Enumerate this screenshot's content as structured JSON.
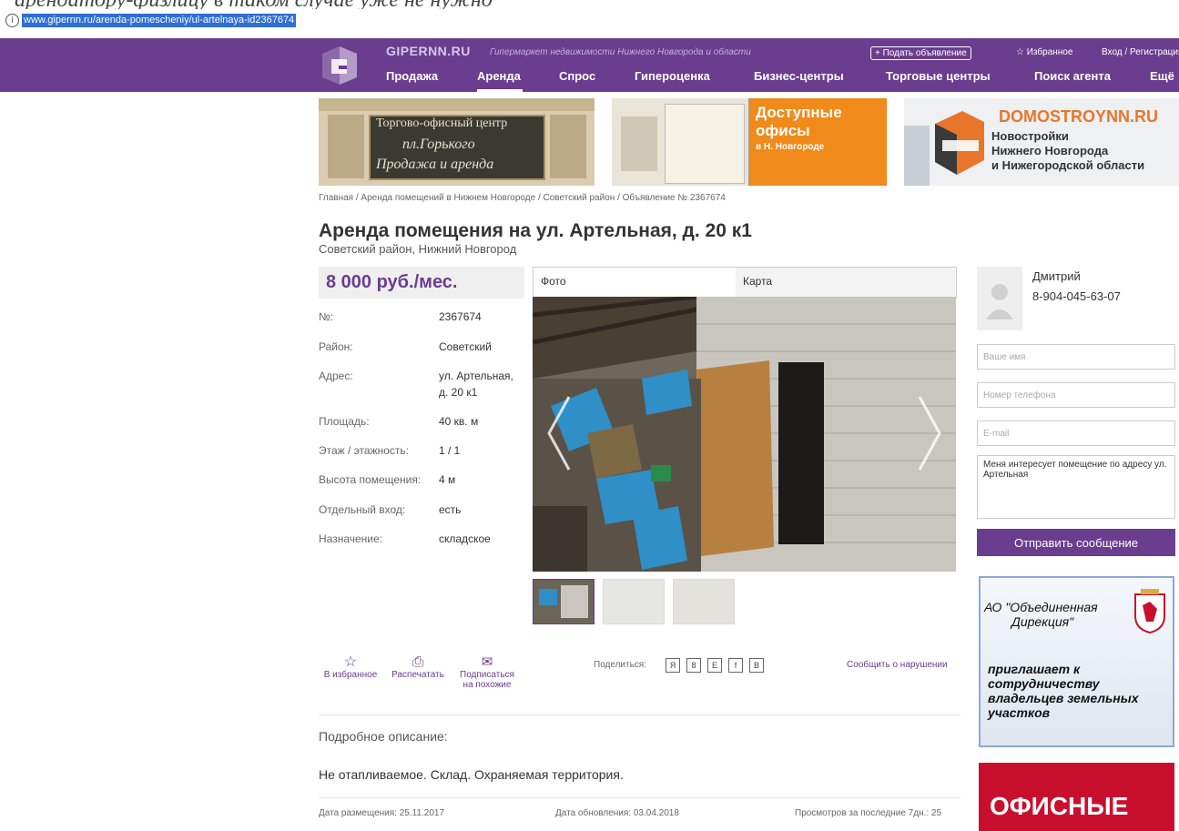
{
  "browser": {
    "url": "www.gipernn.ru/arenda-pomescheniy/ul-artelnaya-id2367674",
    "top_overlay_text": "арендатору-физлицу в таком случае уже не нужно"
  },
  "header": {
    "brand": "GIPERNN.RU",
    "tagline": "Гипермаркет недвижимости Нижнего Новгорода и области",
    "post_ad": "+ Подать объявление",
    "favorites": "☆ Избранное",
    "login": "Вход / Регистрация",
    "nav": [
      "Продажа",
      "Аренда",
      "Спрос",
      "Гипероценка",
      "Бизнес-центры",
      "Торговые центры",
      "Поиск агента",
      "Ещё"
    ],
    "active_nav": "Аренда",
    "colors": {
      "header_bg": "#6a3d8f"
    }
  },
  "banners": {
    "b1": {
      "line1": "Торгово-офисный центр",
      "line2": "пл.Горького",
      "line3": "Продажа и аренда"
    },
    "b2": {
      "line1": "Доступные",
      "line2": "офисы",
      "line3": "в Н. Новгороде"
    },
    "b3": {
      "brand": "DOMOSTROYNN.RU",
      "line1": "Новостройки",
      "line2": "Нижнего Новгорода",
      "line3": "и Нижегородской области"
    }
  },
  "breadcrumb": "Главная / Аренда помещений в Нижнем Новгороде / Советский район / Объявление № 2367674",
  "listing": {
    "title": "Аренда помещения на ул. Артельная, д. 20 к1",
    "subtitle": "Советский район, Нижний Новгород",
    "price": "8 000 руб./мес.",
    "props": [
      {
        "k": "№:",
        "v": "2367674"
      },
      {
        "k": "Район:",
        "v": "Советский"
      },
      {
        "k": "Адрес:",
        "v": "ул. Артельная,",
        "v2": "д. 20 к1"
      },
      {
        "k": "Площадь:",
        "v": "40 кв. м"
      },
      {
        "k": "Этаж / этажность:",
        "v": "1 / 1"
      },
      {
        "k": "Высота помещения:",
        "v": "4 м"
      },
      {
        "k": "Отдельный вход:",
        "v": "есть"
      },
      {
        "k": "Назначение:",
        "v": "складское"
      }
    ]
  },
  "gallery": {
    "tab_photo": "Фото",
    "tab_map": "Карта"
  },
  "actions": {
    "favorite": "В избранное",
    "print": "Распечатать",
    "subscribe1": "Подписаться",
    "subscribe2": "на похожие",
    "share": "Поделиться:",
    "share_icons": [
      "Я",
      "8",
      "Е",
      "f",
      "В"
    ],
    "report": "Сообщить о нарушении"
  },
  "description": {
    "heading": "Подробное описание:",
    "text": "Не отапливаемое. Склад. Охраняемая территория."
  },
  "footer": {
    "posted": "Дата размещения: 25.11.2017",
    "updated": "Дата обновления: 03.04.2018",
    "views": "Просмотров за последние 7дн.: 25"
  },
  "agent": {
    "name": "Дмитрий",
    "phone": "8-904-045-63-07"
  },
  "form": {
    "name_ph": "Ваше имя",
    "phone_ph": "Номер телефона",
    "email_ph": "E-mail",
    "message": "Меня интересует помещение по адресу ул. Артельная",
    "send": "Отправить сообщение"
  },
  "side_ads": {
    "ad1": {
      "line1": "АО \"Объединенная",
      "line2": "Дирекция\"",
      "line3": "приглашает к",
      "line4": "сотрудничеству",
      "line5": "владельцев земельных",
      "line6": "участков"
    },
    "ad2": {
      "text": "ОФИСНЫЕ"
    }
  }
}
